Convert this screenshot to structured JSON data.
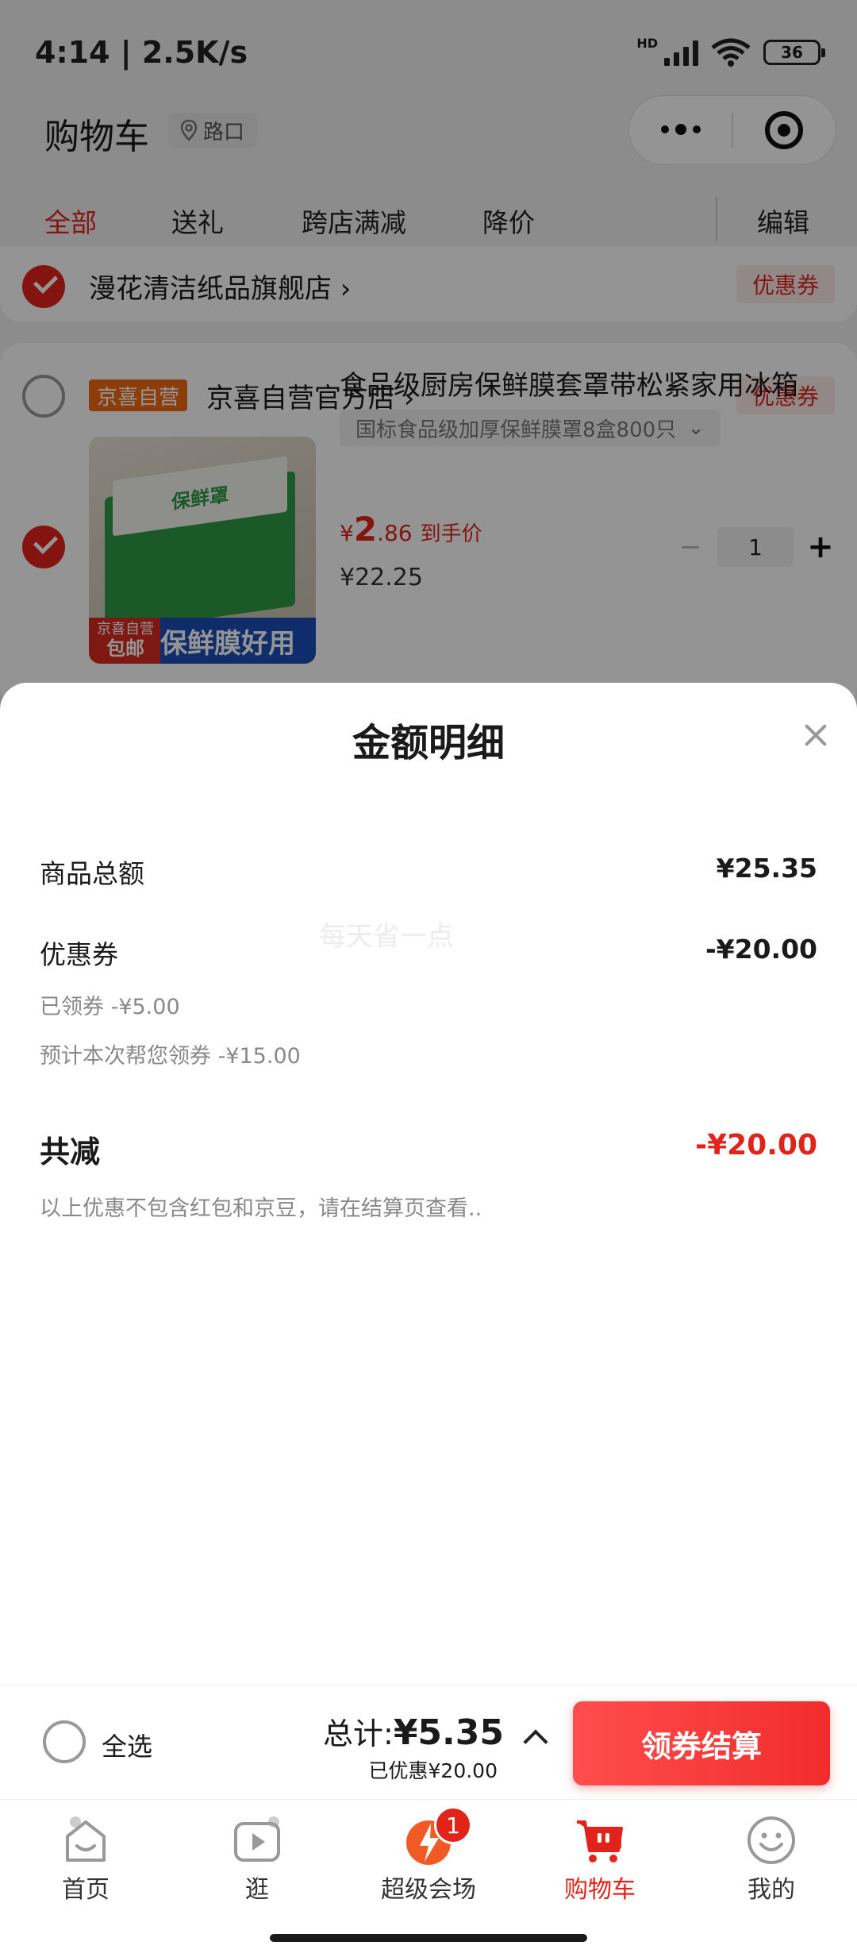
{
  "status_bar": {
    "time": "4:14 | 2.5K/s",
    "hd": "HD",
    "wifi_sub": "6",
    "battery": "36"
  },
  "header": {
    "title": "购物车",
    "location": "路口"
  },
  "tabs": [
    "全部",
    "送礼",
    "跨店满减",
    "降价",
    "编辑"
  ],
  "stores": [
    {
      "name": "漫花清洁纸品旗舰店",
      "coupon": "优惠券"
    },
    {
      "tag": "京喜自营",
      "name": "京喜自营官方店",
      "coupon": "优惠券"
    }
  ],
  "product": {
    "title": "食品级厨房保鲜膜套罩带松紧家用冰箱",
    "spec": "国标食品级加厚保鲜膜罩8盒800只",
    "price_symbol": "¥",
    "price_int": "2",
    "price_dec": ".86",
    "price_suffix": "到手价",
    "original_price": "¥22.25",
    "quantity": "1",
    "image_badge_top": "京喜自营",
    "image_badge_bottom": "包邮",
    "image_text": "保鲜膜好用",
    "box_label": "保鲜罩"
  },
  "sheet": {
    "title": "金额明细",
    "goods_total_label": "商品总额",
    "goods_total_value": "¥25.35",
    "coupon_label": "优惠券",
    "coupon_value": "-¥20.00",
    "claimed_line": "已领券 -¥5.00",
    "estimate_line": "预计本次帮您领券 -¥15.00",
    "watermark": "每天省一点",
    "total_reduce_label": "共减",
    "total_reduce_value": "-¥20.00",
    "note": "以上优惠不包含红包和京豆，请在结算页查看.."
  },
  "checkout": {
    "select_all": "全选",
    "total_prefix": "总计:",
    "total_value": "¥5.35",
    "discount": "已优惠¥20.00",
    "button": "领券结算"
  },
  "nav": {
    "items": [
      "首页",
      "逛",
      "超级会场",
      "购物车",
      "我的"
    ],
    "badge": "1"
  },
  "colors": {
    "accent": "#e2231a",
    "tag_orange": "#f36a12"
  }
}
